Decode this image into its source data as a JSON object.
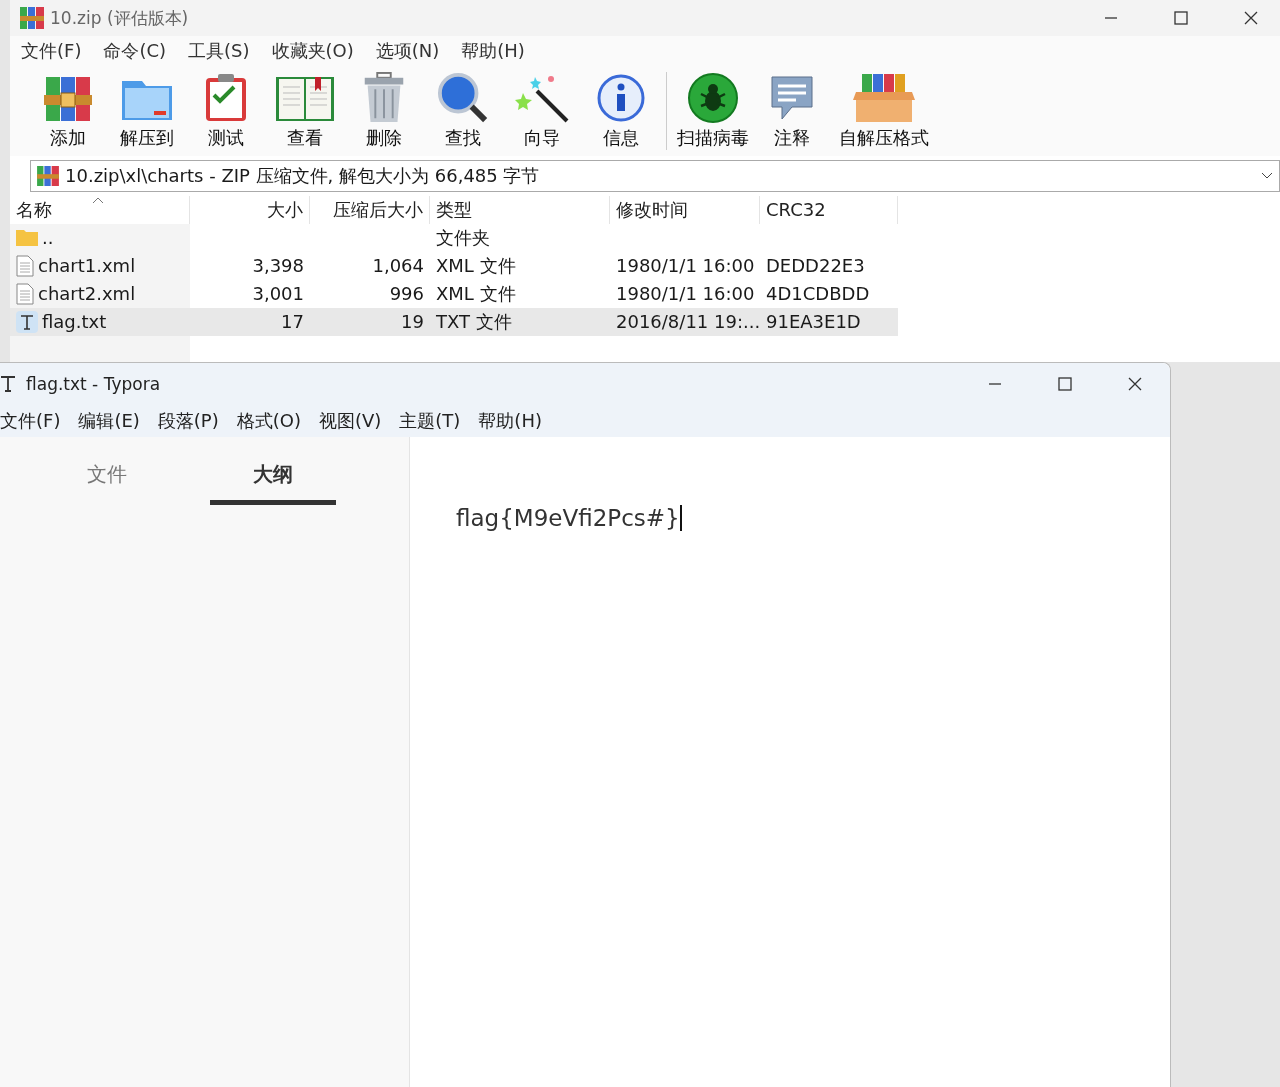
{
  "archive_window": {
    "title": "10.zip (评估版本)",
    "menu": [
      "文件(F)",
      "命令(C)",
      "工具(S)",
      "收藏夹(O)",
      "选项(N)",
      "帮助(H)"
    ],
    "toolbar": [
      {
        "label": "添加"
      },
      {
        "label": "解压到"
      },
      {
        "label": "测试"
      },
      {
        "label": "查看"
      },
      {
        "label": "删除"
      },
      {
        "label": "查找"
      },
      {
        "label": "向导"
      },
      {
        "label": "信息"
      },
      {
        "label": "扫描病毒"
      },
      {
        "label": "注释"
      },
      {
        "label": "自解压格式"
      }
    ],
    "address": "10.zip\\xl\\charts - ZIP 压缩文件, 解包大小为 66,485 字节",
    "table": {
      "columns": [
        {
          "label": "名称",
          "sorted": true
        },
        {
          "label": "大小",
          "sorted": false
        },
        {
          "label": "压缩后大小",
          "sorted": false
        },
        {
          "label": "类型",
          "sorted": false
        },
        {
          "label": "修改时间",
          "sorted": false
        },
        {
          "label": "CRC32",
          "sorted": false
        }
      ],
      "rows": [
        {
          "kind": "folder",
          "selected": false,
          "name": "..",
          "type": "文件夹"
        },
        {
          "kind": "document",
          "selected": false,
          "name": "chart1.xml",
          "size": "3,398",
          "packed": "1,064",
          "type": "XML 文件",
          "modified": "1980/1/1 16:00",
          "crc": "DEDD22E3"
        },
        {
          "kind": "document",
          "selected": false,
          "name": "chart2.xml",
          "size": "3,001",
          "packed": "996",
          "type": "XML 文件",
          "modified": "1980/1/1 16:00",
          "crc": "4D1CDBDD"
        },
        {
          "kind": "text",
          "selected": true,
          "name": "flag.txt",
          "size": "17",
          "packed": "19",
          "type": "TXT 文件",
          "modified": "2016/8/11 19:...",
          "crc": "91EA3E1D"
        }
      ]
    }
  },
  "editor_window": {
    "title": "flag.txt - Typora",
    "menu": [
      "文件(F)",
      "编辑(E)",
      "段落(P)",
      "格式(O)",
      "视图(V)",
      "主题(T)",
      "帮助(H)"
    ],
    "sidebar_tabs": [
      {
        "label": "文件",
        "selected": false
      },
      {
        "label": "大纲",
        "selected": true
      }
    ],
    "content": "flag{M9eVfi2Pcs#}"
  }
}
